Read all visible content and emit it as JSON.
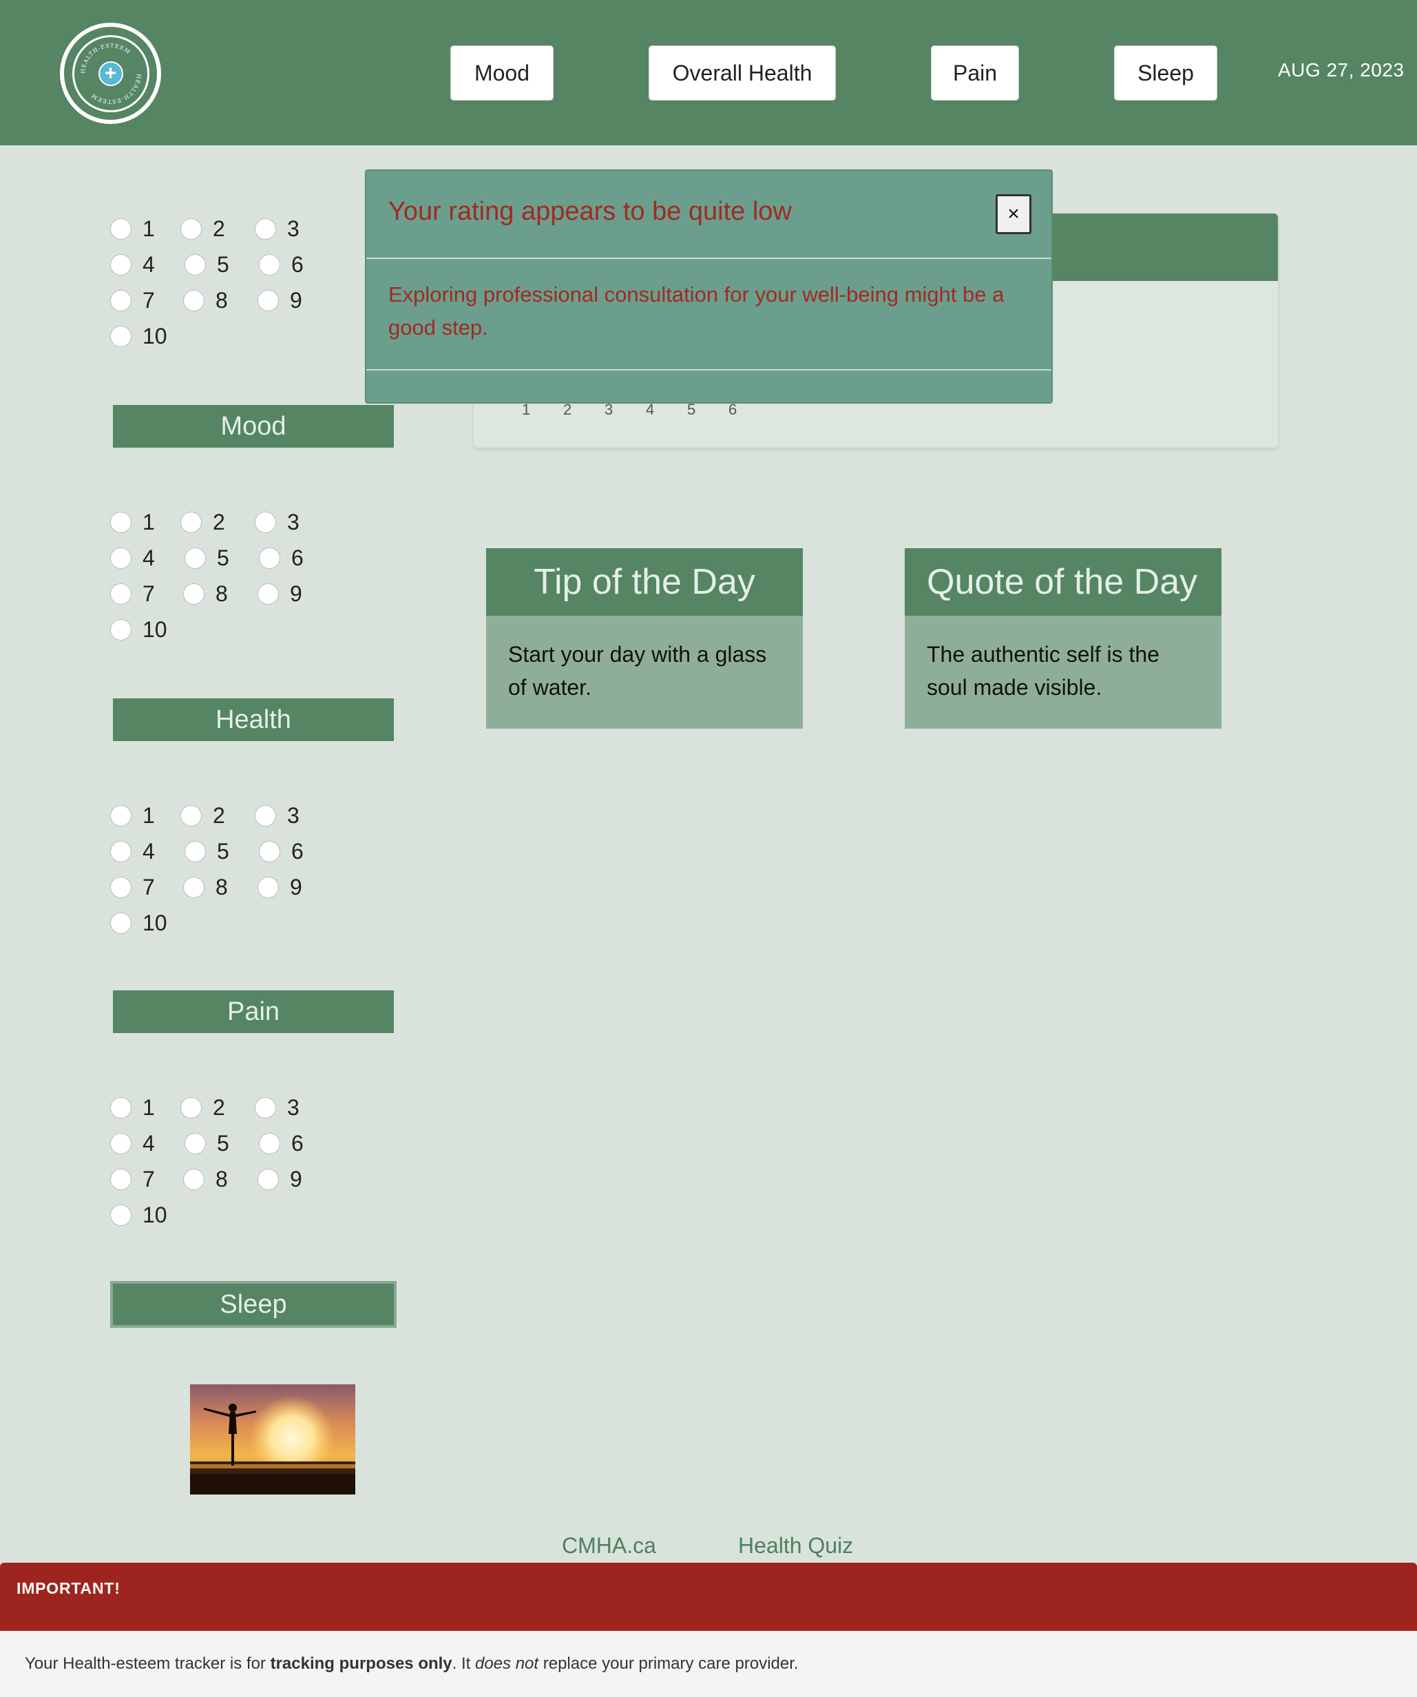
{
  "header": {
    "logo_text": "HEALTH-ESTEEM",
    "nav": [
      "Mood",
      "Overall Health",
      "Pain",
      "Sleep"
    ],
    "date": "AUG 27, 2023"
  },
  "ratings": {
    "options": [
      "1",
      "2",
      "3",
      "4",
      "5",
      "6",
      "7",
      "8",
      "9",
      "10"
    ],
    "categories": [
      "Mood",
      "Health",
      "Pain",
      "Sleep"
    ]
  },
  "chart": {
    "x_ticks": [
      "1",
      "2",
      "3",
      "4",
      "5",
      "6"
    ]
  },
  "modal": {
    "title": "Your rating appears to be quite low",
    "close_label": "×",
    "body": "Exploring professional consultation for your well-being might be a good step."
  },
  "tip": {
    "title": "Tip of the Day",
    "text": "Start your day with a glass of water."
  },
  "quote": {
    "title": "Quote of the Day",
    "text": "The authentic self is the soul made visible."
  },
  "footer_links": [
    "CMHA.ca",
    "Health Quiz"
  ],
  "warning": {
    "title": "IMPORTANT!",
    "text_prefix": "Your Health-esteem tracker is for ",
    "text_bold": "tracking purposes only",
    "text_mid": ". It ",
    "text_italic": "does not",
    "text_suffix": " replace your primary care provider."
  },
  "colors": {
    "header": "#558563",
    "page_bg": "#d9e3dc",
    "modal_bg": "#6b9e8d",
    "alert_text": "#a12a22",
    "warning_bar": "#9e251f",
    "card_body": "#8fae99"
  }
}
